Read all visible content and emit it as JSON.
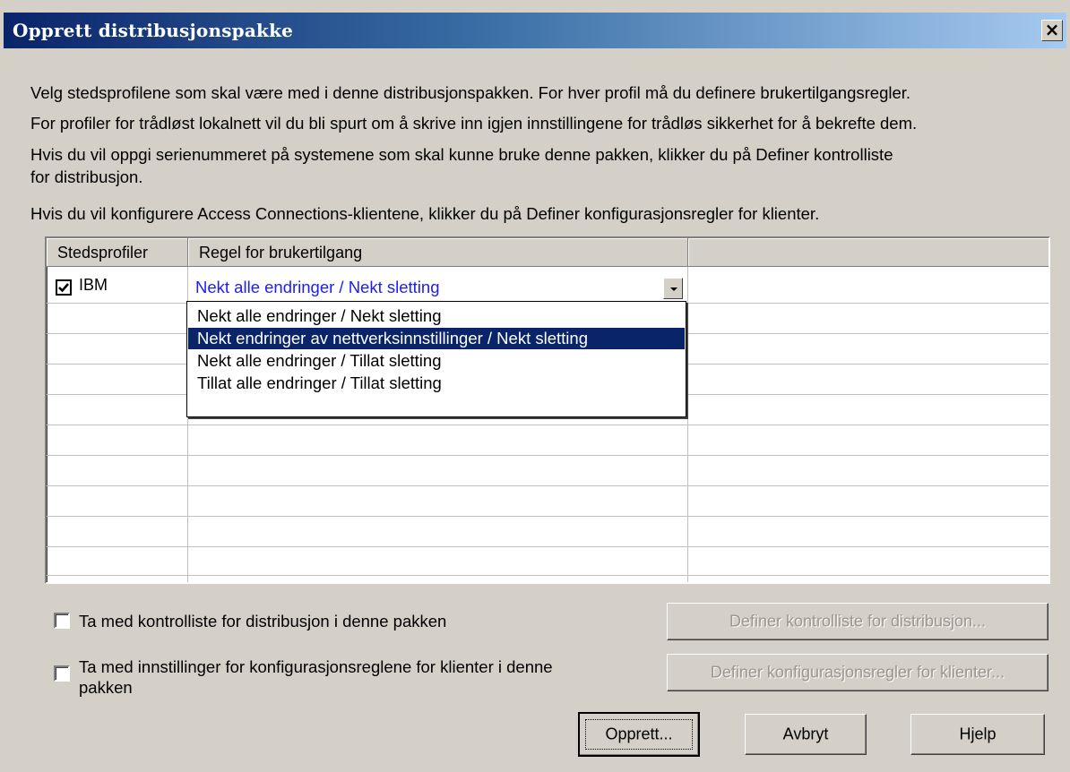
{
  "window": {
    "title": "Opprett distribusjonspakke",
    "close_label": "×"
  },
  "intro": {
    "line1": "Velg stedsprofilene som skal være med i denne distribusjonspakken. For hver profil må du definere brukertilgangsregler.",
    "line2": "For profiler for trådløst lokalnett vil du bli spurt om å skrive inn igjen innstillingene for trådløs sikkerhet for å bekrefte dem.",
    "line3a": "Hvis du vil oppgi serienummeret på systemene som skal kunne bruke denne pakken, klikker du på Definer kontrolliste",
    "line3b": "for distribusjon.",
    "line4": "Hvis du vil konfigurere Access Connections-klientene, klikker du på Definer konfigurasjonsregler for klienter."
  },
  "grid": {
    "columns": [
      "Stedsprofiler",
      "Regel for brukertilgang",
      ""
    ],
    "rows": [
      {
        "checked": true,
        "profile": "IBM",
        "rule": "Nekt alle endringer / Nekt sletting"
      }
    ]
  },
  "dropdown": {
    "options": [
      "Nekt alle endringer / Nekt sletting",
      "Nekt endringer av nettverksinnstillinger / Nekt sletting",
      "Nekt alle endringer / Tillat sletting",
      "Tillat alle endringer / Tillat sletting"
    ],
    "highlighted_index": 1
  },
  "options": {
    "include_checklist": {
      "label": "Ta med kontrolliste for distribusjon i denne pakken",
      "checked": false
    },
    "include_config_line1": "Ta med innstillinger for konfigurasjonsreglene for klienter i denne",
    "include_config_line2": "pakken",
    "include_config_checked": false
  },
  "buttons": {
    "define_checklist": "Definer kontrolliste for distribusjon...",
    "define_config": "Definer konfigurasjonsregler for klienter...",
    "create": "Opprett...",
    "cancel": "Avbryt",
    "help": "Hjelp"
  },
  "colors": {
    "title_gradient_start": "#0a246a",
    "title_gradient_end": "#a6caf0",
    "selection": "#0a246a",
    "link_text": "#1c1cff",
    "dialog_bg": "#d4d0c8"
  }
}
